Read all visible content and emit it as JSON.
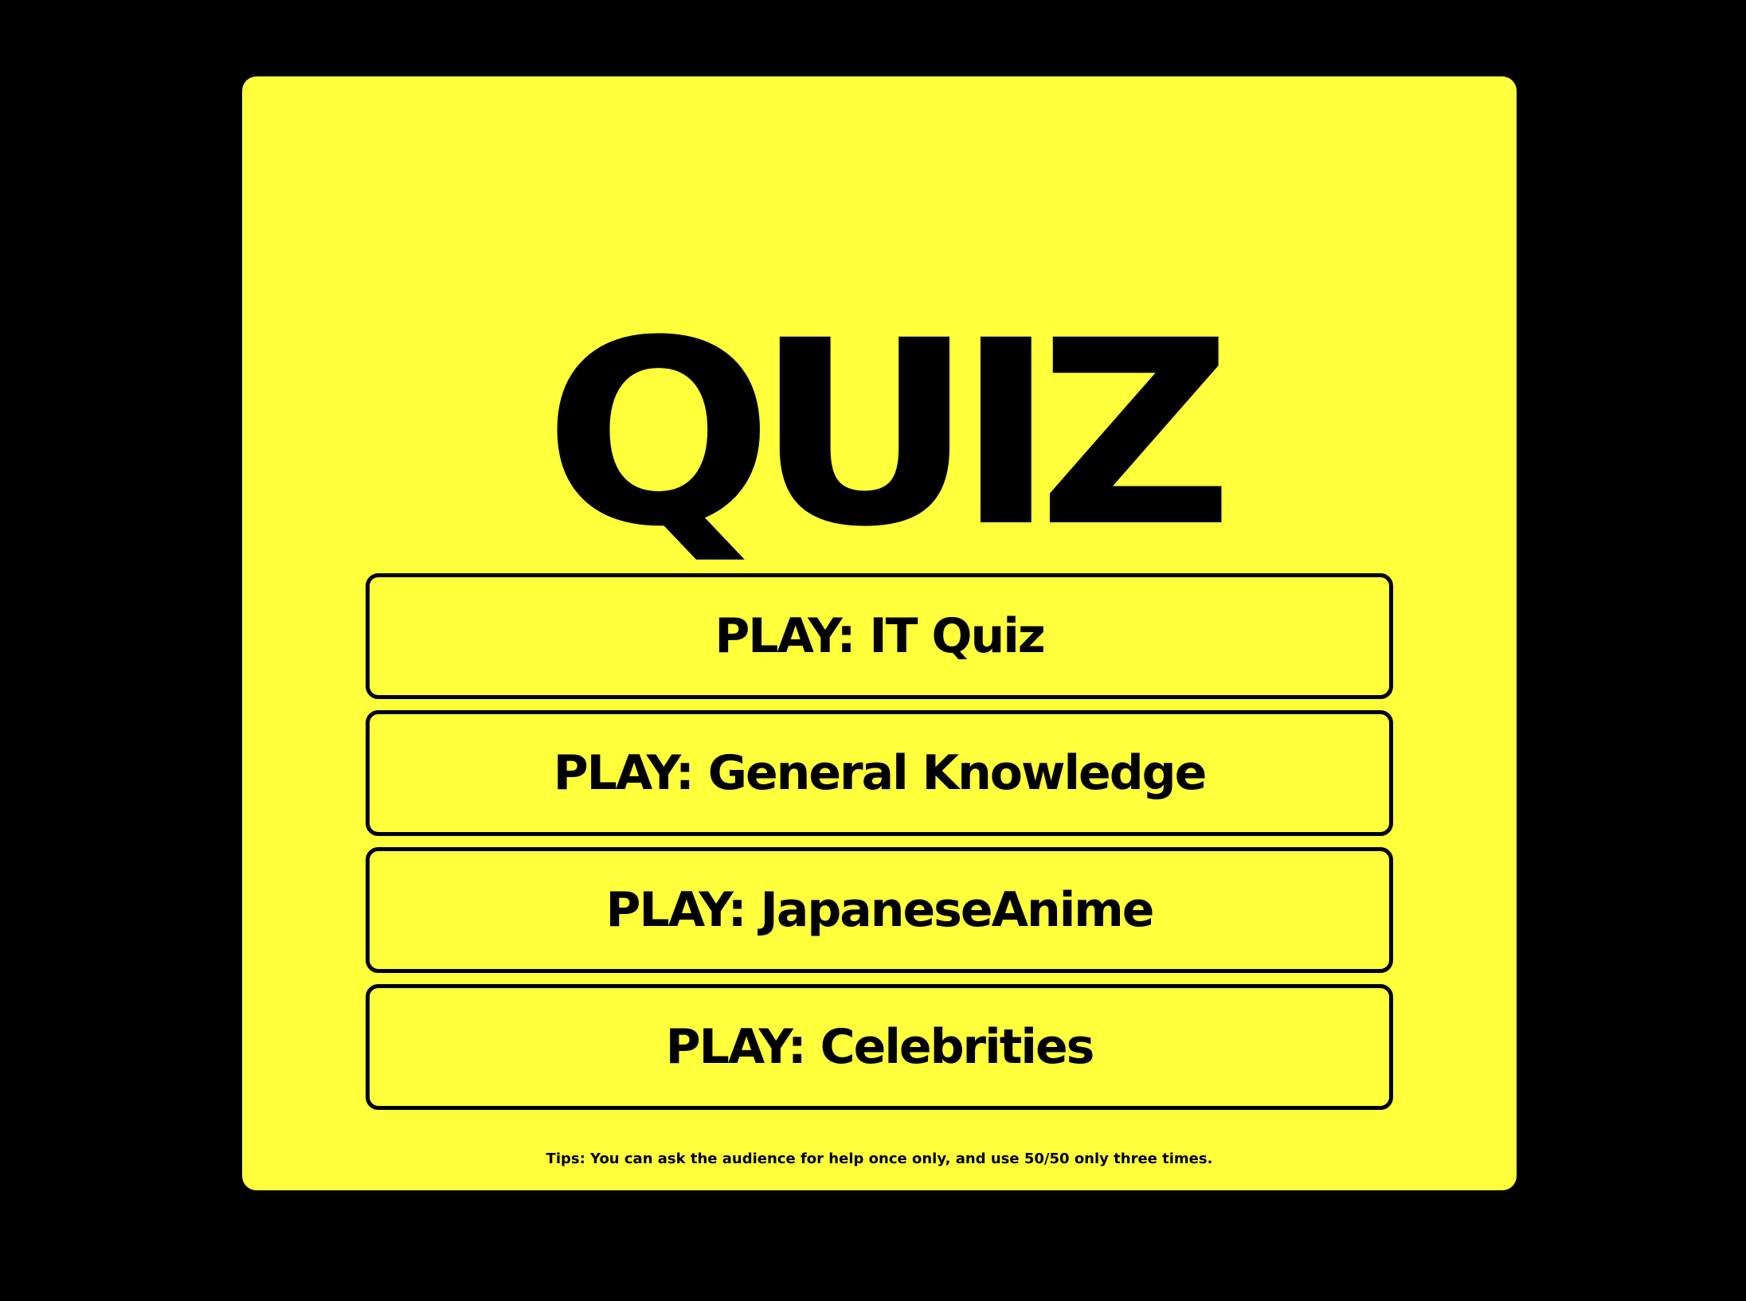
{
  "page": {
    "title": "QUIZ",
    "background_color": "#000000",
    "card_color": "#ffff3b"
  },
  "menu": {
    "buttons": [
      {
        "label": "PLAY: IT Quiz"
      },
      {
        "label": "PLAY: General Knowledge"
      },
      {
        "label": "PLAY: JapaneseAnime"
      },
      {
        "label": "PLAY: Celebrities"
      }
    ]
  },
  "footer": {
    "tips": "Tips: You can ask the audience for help once only, and use 50/50 only three times."
  }
}
